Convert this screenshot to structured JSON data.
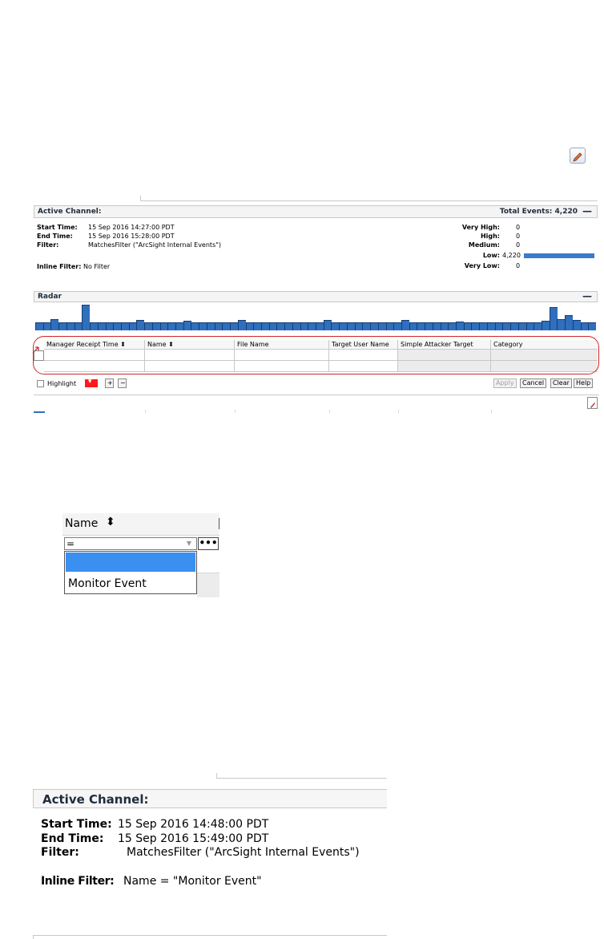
{
  "active_channel": {
    "header_label": "Active Channel:",
    "total_events": "Total Events: 4,220",
    "collapse": "—",
    "start_label": "Start Time:",
    "start_value": "15 Sep 2016 14:27:00 PDT",
    "end_label": "End Time:",
    "end_value": "15 Sep 2016 15:28:00 PDT",
    "filter_label": "Filter:",
    "filter_value": "MatchesFilter (\"ArcSight Internal Events\")",
    "inline_label": "Inline Filter:",
    "inline_value": "No Filter",
    "severity": [
      {
        "label": "Very High:",
        "value": "0"
      },
      {
        "label": "High:",
        "value": "0"
      },
      {
        "label": "Medium:",
        "value": "0"
      },
      {
        "label": "Low:",
        "value": "4,220"
      },
      {
        "label": "Very Low:",
        "value": "0"
      }
    ]
  },
  "radar": {
    "label": "Radar",
    "collapse": "—",
    "bar_levels": [
      0.3,
      0.3,
      0.42,
      0.3,
      0.3,
      0.3,
      0.95,
      0.3,
      0.3,
      0.3,
      0.3,
      0.3,
      0.3,
      0.38,
      0.3,
      0.3,
      0.3,
      0.3,
      0.3,
      0.35,
      0.3,
      0.3,
      0.3,
      0.3,
      0.3,
      0.3,
      0.38,
      0.3,
      0.3,
      0.3,
      0.3,
      0.3,
      0.3,
      0.3,
      0.3,
      0.3,
      0.3,
      0.38,
      0.3,
      0.3,
      0.3,
      0.3,
      0.3,
      0.3,
      0.3,
      0.3,
      0.3,
      0.38,
      0.3,
      0.3,
      0.3,
      0.3,
      0.3,
      0.3,
      0.32,
      0.3,
      0.3,
      0.3,
      0.3,
      0.3,
      0.3,
      0.3,
      0.3,
      0.3,
      0.3,
      0.35,
      0.85,
      0.42,
      0.55,
      0.38,
      0.3,
      0.3
    ]
  },
  "grid": {
    "columns": [
      "Manager Receipt Time ⬍",
      "Name ⬍",
      "File Name",
      "Target User Name",
      "Simple Attacker Target",
      "Category"
    ]
  },
  "footer": {
    "highlight": "Highlight",
    "plus": "+",
    "minus": "−",
    "apply": "Apply",
    "cancel": "Cancel",
    "clear": "Clear",
    "help": "Help"
  },
  "name_filter": {
    "title": "Name",
    "sort_glyph": "⬍",
    "operator": "=",
    "more": "•••",
    "option": "Monitor Event"
  },
  "active_channel_2": {
    "header_label": "Active Channel:",
    "start_label": "Start Time:",
    "start_value": "15 Sep 2016 14:48:00 PDT",
    "end_label": "End Time:",
    "end_value": "15 Sep 2016 15:49:00 PDT",
    "filter_label": "Filter:",
    "filter_value": "MatchesFilter (\"ArcSight Internal Events\")",
    "inline_label": "Inline Filter:",
    "inline_value": "Name = \"Monitor Event\""
  },
  "colors": {
    "bar": "#2f6fbd",
    "annotation_red": "#d0282a",
    "selection_blue": "#3b8ff0"
  }
}
